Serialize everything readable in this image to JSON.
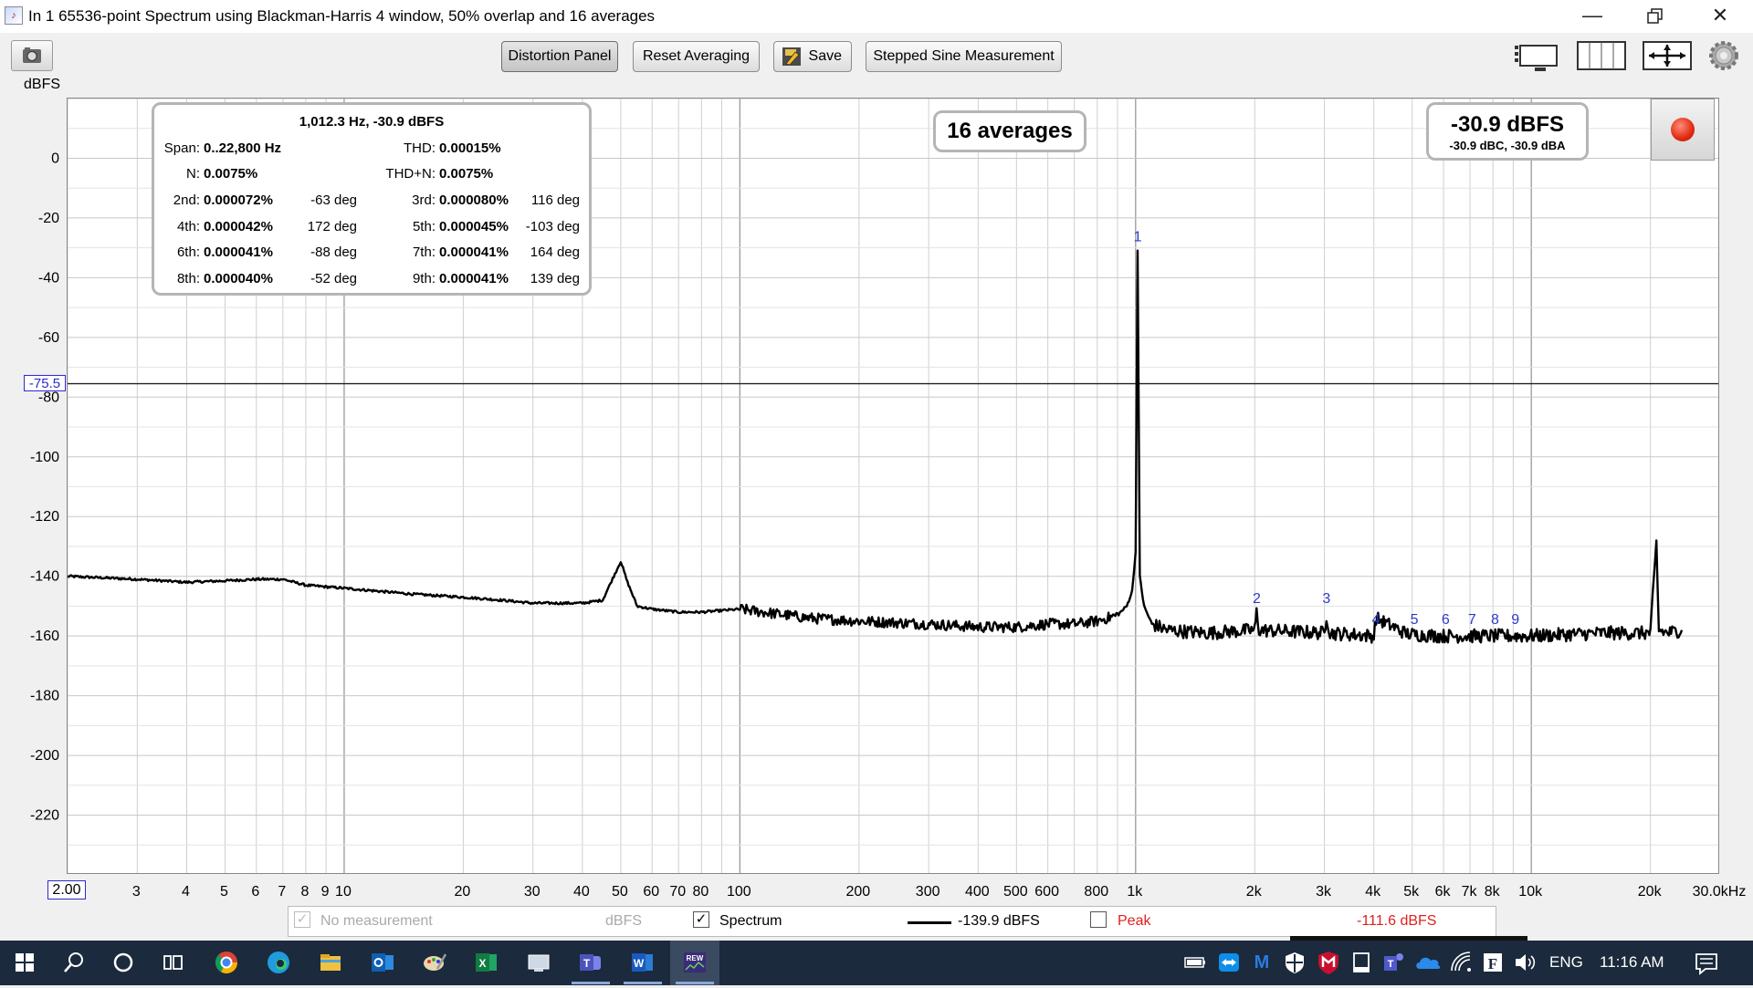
{
  "window": {
    "title": "In 1 65536-point Spectrum using Blackman-Harris 4 window, 50% overlap and 16 averages",
    "minimize_icon": "minimize-icon",
    "restore_icon": "restore-icon",
    "close_icon": "close-icon"
  },
  "toolbar": {
    "unit_label": "dBFS",
    "camera_icon": "camera-icon",
    "buttons": {
      "distortion_panel": "Distortion Panel",
      "reset_averaging": "Reset Averaging",
      "save": "Save",
      "stepped_sine": "Stepped Sine Measurement"
    },
    "right_icons": [
      "layout-panels-icon",
      "columns-icon",
      "fit-axes-icon",
      "settings-gear-icon"
    ]
  },
  "distortion_panel": {
    "header": "1,012.3 Hz, -30.9 dBFS",
    "span_label": "Span:",
    "span_value": "0..22,800 Hz",
    "thd_label": "THD:",
    "thd_value": "0.00015%",
    "n_label": "N:",
    "n_value": "0.0075%",
    "thdn_label": "THD+N:",
    "thdn_value": "0.0075%",
    "harmonics": [
      {
        "l_label": "2nd:",
        "l_value": "0.000072%",
        "l_phase": "-63 deg",
        "r_label": "3rd:",
        "r_value": "0.000080%",
        "r_phase": "116 deg"
      },
      {
        "l_label": "4th:",
        "l_value": "0.000042%",
        "l_phase": "172 deg",
        "r_label": "5th:",
        "r_value": "0.000045%",
        "r_phase": "-103 deg"
      },
      {
        "l_label": "6th:",
        "l_value": "0.000041%",
        "l_phase": "-88 deg",
        "r_label": "7th:",
        "r_value": "0.000041%",
        "r_phase": "164 deg"
      },
      {
        "l_label": "8th:",
        "l_value": "0.000040%",
        "l_phase": "-52 deg",
        "r_label": "9th:",
        "r_value": "0.000041%",
        "r_phase": "139 deg"
      }
    ]
  },
  "averages_badge": "16 averages",
  "level_display": {
    "main": "-30.9 dBFS",
    "sub": "-30.9 dBC, -30.9 dBA"
  },
  "record_icon": "record-icon",
  "cursor_value": "-75.5",
  "x_start_value": "2.00",
  "chart_data": {
    "type": "line",
    "title": "",
    "ylabel": "dBFS",
    "xscale": "log",
    "xlim": [
      2,
      30000
    ],
    "ylim": [
      -240,
      20
    ],
    "yticks": [
      0,
      -20,
      -40,
      -60,
      -80,
      -100,
      -120,
      -140,
      -160,
      -180,
      -200,
      -220
    ],
    "ytick_labels": [
      "0",
      "-20",
      "-40",
      "-60",
      "-80",
      "-100",
      "-120",
      "-140",
      "-160",
      "-180",
      "-200",
      "-220"
    ],
    "xticks": [
      3,
      4,
      5,
      6,
      7,
      8,
      9,
      10,
      20,
      30,
      40,
      50,
      60,
      70,
      80,
      100,
      200,
      300,
      400,
      500,
      600,
      800,
      1000,
      2000,
      3000,
      4000,
      5000,
      6000,
      7000,
      8000,
      10000,
      20000,
      30000
    ],
    "xtick_labels": [
      "3",
      "4",
      "5",
      "6",
      "7",
      "8",
      "9",
      "10",
      "20",
      "30",
      "40",
      "50",
      "60",
      "70",
      "80",
      "100",
      "200",
      "300",
      "400",
      "500",
      "600",
      "800",
      "1k",
      "2k",
      "3k",
      "4k",
      "5k",
      "6k",
      "7k",
      "8k",
      "10k",
      "20k",
      "30.0kHz"
    ],
    "grid": true,
    "cursor_y": -75.5,
    "series": [
      {
        "name": "Spectrum",
        "color": "#000000",
        "x": [
          2,
          3,
          4,
          5,
          6,
          7,
          8,
          10,
          15,
          20,
          25,
          30,
          35,
          40,
          45,
          48,
          50,
          52,
          55,
          60,
          70,
          80,
          100,
          150,
          200,
          300,
          400,
          500,
          600,
          700,
          800,
          900,
          950,
          980,
          1000,
          1012,
          1025,
          1050,
          1100,
          1200,
          1500,
          2000,
          2022,
          2050,
          3000,
          3035,
          3100,
          4000,
          4050,
          4800,
          5000,
          6000,
          7000,
          8000,
          9000,
          10000,
          15000,
          20000,
          20700,
          21000,
          22000,
          24000
        ],
        "y": [
          -140,
          -141,
          -142,
          -141.5,
          -141,
          -141,
          -143,
          -144,
          -146,
          -147,
          -148,
          -149,
          -149,
          -149,
          -148,
          -140,
          -135,
          -142,
          -150,
          -151,
          -152,
          -152,
          -151,
          -154,
          -155,
          -156,
          -157,
          -157,
          -156,
          -156,
          -155,
          -153,
          -150,
          -145,
          -132,
          -31,
          -140,
          -150,
          -156,
          -158,
          -159,
          -158,
          -152,
          -158,
          -159,
          -153,
          -159,
          -160,
          -154,
          -159,
          -159.5,
          -160,
          -160,
          -160,
          -160,
          -160,
          -159,
          -159,
          -129,
          -158,
          -159,
          -158
        ]
      }
    ],
    "harmonic_markers": [
      {
        "label": "1",
        "x": 1012,
        "y": -30.9
      },
      {
        "label": "2",
        "x": 2024,
        "y": -152
      },
      {
        "label": "3",
        "x": 3037,
        "y": -152
      },
      {
        "label": "4",
        "x": 4049,
        "y": -159
      },
      {
        "label": "5",
        "x": 5061,
        "y": -159
      },
      {
        "label": "6",
        "x": 6074,
        "y": -159
      },
      {
        "label": "7",
        "x": 7086,
        "y": -159
      },
      {
        "label": "8",
        "x": 8098,
        "y": -159
      },
      {
        "label": "9",
        "x": 9111,
        "y": -159
      }
    ]
  },
  "legend": {
    "no_measurement_label": "No measurement",
    "no_measurement_unit": "dBFS",
    "spectrum_label": "Spectrum",
    "spectrum_value": "-139.9 dBFS",
    "peak_label": "Peak",
    "peak_value": "-111.6 dBFS",
    "peak_color": "#e02020"
  },
  "taskbar": {
    "icons": [
      "windows-start-icon",
      "search-icon",
      "cortana-icon",
      "task-view-icon",
      "chrome-icon",
      "edge-icon",
      "file-explorer-icon",
      "outlook-icon",
      "paint-icon",
      "excel-icon",
      "app-icon",
      "teams-icon",
      "word-icon",
      "rew-icon"
    ],
    "tray_icons": [
      "battery-icon",
      "teamviewer-icon",
      "malwarebytes-icon",
      "defender-icon",
      "mcafee-icon",
      "tablet-icon",
      "teams-tray-icon",
      "onedrive-icon",
      "wifi-icon",
      "font-icon",
      "volume-icon"
    ],
    "language": "ENG",
    "time": "11:16 AM",
    "notifications_icon": "notifications-icon"
  }
}
